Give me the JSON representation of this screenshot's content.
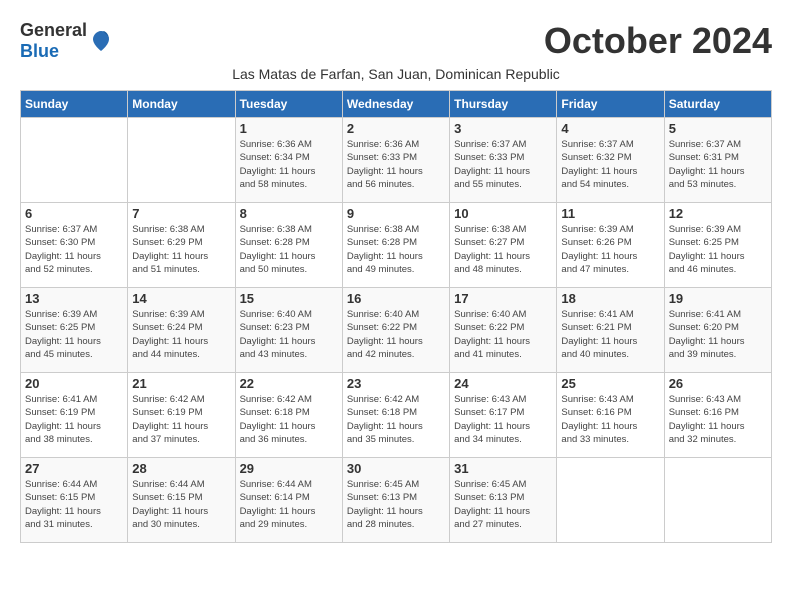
{
  "header": {
    "logo_general": "General",
    "logo_blue": "Blue",
    "month_title": "October 2024",
    "subtitle": "Las Matas de Farfan, San Juan, Dominican Republic"
  },
  "days_of_week": [
    "Sunday",
    "Monday",
    "Tuesday",
    "Wednesday",
    "Thursday",
    "Friday",
    "Saturday"
  ],
  "weeks": [
    [
      {
        "day": "",
        "info": ""
      },
      {
        "day": "",
        "info": ""
      },
      {
        "day": "1",
        "info": "Sunrise: 6:36 AM\nSunset: 6:34 PM\nDaylight: 11 hours\nand 58 minutes."
      },
      {
        "day": "2",
        "info": "Sunrise: 6:36 AM\nSunset: 6:33 PM\nDaylight: 11 hours\nand 56 minutes."
      },
      {
        "day": "3",
        "info": "Sunrise: 6:37 AM\nSunset: 6:33 PM\nDaylight: 11 hours\nand 55 minutes."
      },
      {
        "day": "4",
        "info": "Sunrise: 6:37 AM\nSunset: 6:32 PM\nDaylight: 11 hours\nand 54 minutes."
      },
      {
        "day": "5",
        "info": "Sunrise: 6:37 AM\nSunset: 6:31 PM\nDaylight: 11 hours\nand 53 minutes."
      }
    ],
    [
      {
        "day": "6",
        "info": "Sunrise: 6:37 AM\nSunset: 6:30 PM\nDaylight: 11 hours\nand 52 minutes."
      },
      {
        "day": "7",
        "info": "Sunrise: 6:38 AM\nSunset: 6:29 PM\nDaylight: 11 hours\nand 51 minutes."
      },
      {
        "day": "8",
        "info": "Sunrise: 6:38 AM\nSunset: 6:28 PM\nDaylight: 11 hours\nand 50 minutes."
      },
      {
        "day": "9",
        "info": "Sunrise: 6:38 AM\nSunset: 6:28 PM\nDaylight: 11 hours\nand 49 minutes."
      },
      {
        "day": "10",
        "info": "Sunrise: 6:38 AM\nSunset: 6:27 PM\nDaylight: 11 hours\nand 48 minutes."
      },
      {
        "day": "11",
        "info": "Sunrise: 6:39 AM\nSunset: 6:26 PM\nDaylight: 11 hours\nand 47 minutes."
      },
      {
        "day": "12",
        "info": "Sunrise: 6:39 AM\nSunset: 6:25 PM\nDaylight: 11 hours\nand 46 minutes."
      }
    ],
    [
      {
        "day": "13",
        "info": "Sunrise: 6:39 AM\nSunset: 6:25 PM\nDaylight: 11 hours\nand 45 minutes."
      },
      {
        "day": "14",
        "info": "Sunrise: 6:39 AM\nSunset: 6:24 PM\nDaylight: 11 hours\nand 44 minutes."
      },
      {
        "day": "15",
        "info": "Sunrise: 6:40 AM\nSunset: 6:23 PM\nDaylight: 11 hours\nand 43 minutes."
      },
      {
        "day": "16",
        "info": "Sunrise: 6:40 AM\nSunset: 6:22 PM\nDaylight: 11 hours\nand 42 minutes."
      },
      {
        "day": "17",
        "info": "Sunrise: 6:40 AM\nSunset: 6:22 PM\nDaylight: 11 hours\nand 41 minutes."
      },
      {
        "day": "18",
        "info": "Sunrise: 6:41 AM\nSunset: 6:21 PM\nDaylight: 11 hours\nand 40 minutes."
      },
      {
        "day": "19",
        "info": "Sunrise: 6:41 AM\nSunset: 6:20 PM\nDaylight: 11 hours\nand 39 minutes."
      }
    ],
    [
      {
        "day": "20",
        "info": "Sunrise: 6:41 AM\nSunset: 6:19 PM\nDaylight: 11 hours\nand 38 minutes."
      },
      {
        "day": "21",
        "info": "Sunrise: 6:42 AM\nSunset: 6:19 PM\nDaylight: 11 hours\nand 37 minutes."
      },
      {
        "day": "22",
        "info": "Sunrise: 6:42 AM\nSunset: 6:18 PM\nDaylight: 11 hours\nand 36 minutes."
      },
      {
        "day": "23",
        "info": "Sunrise: 6:42 AM\nSunset: 6:18 PM\nDaylight: 11 hours\nand 35 minutes."
      },
      {
        "day": "24",
        "info": "Sunrise: 6:43 AM\nSunset: 6:17 PM\nDaylight: 11 hours\nand 34 minutes."
      },
      {
        "day": "25",
        "info": "Sunrise: 6:43 AM\nSunset: 6:16 PM\nDaylight: 11 hours\nand 33 minutes."
      },
      {
        "day": "26",
        "info": "Sunrise: 6:43 AM\nSunset: 6:16 PM\nDaylight: 11 hours\nand 32 minutes."
      }
    ],
    [
      {
        "day": "27",
        "info": "Sunrise: 6:44 AM\nSunset: 6:15 PM\nDaylight: 11 hours\nand 31 minutes."
      },
      {
        "day": "28",
        "info": "Sunrise: 6:44 AM\nSunset: 6:15 PM\nDaylight: 11 hours\nand 30 minutes."
      },
      {
        "day": "29",
        "info": "Sunrise: 6:44 AM\nSunset: 6:14 PM\nDaylight: 11 hours\nand 29 minutes."
      },
      {
        "day": "30",
        "info": "Sunrise: 6:45 AM\nSunset: 6:13 PM\nDaylight: 11 hours\nand 28 minutes."
      },
      {
        "day": "31",
        "info": "Sunrise: 6:45 AM\nSunset: 6:13 PM\nDaylight: 11 hours\nand 27 minutes."
      },
      {
        "day": "",
        "info": ""
      },
      {
        "day": "",
        "info": ""
      }
    ]
  ]
}
